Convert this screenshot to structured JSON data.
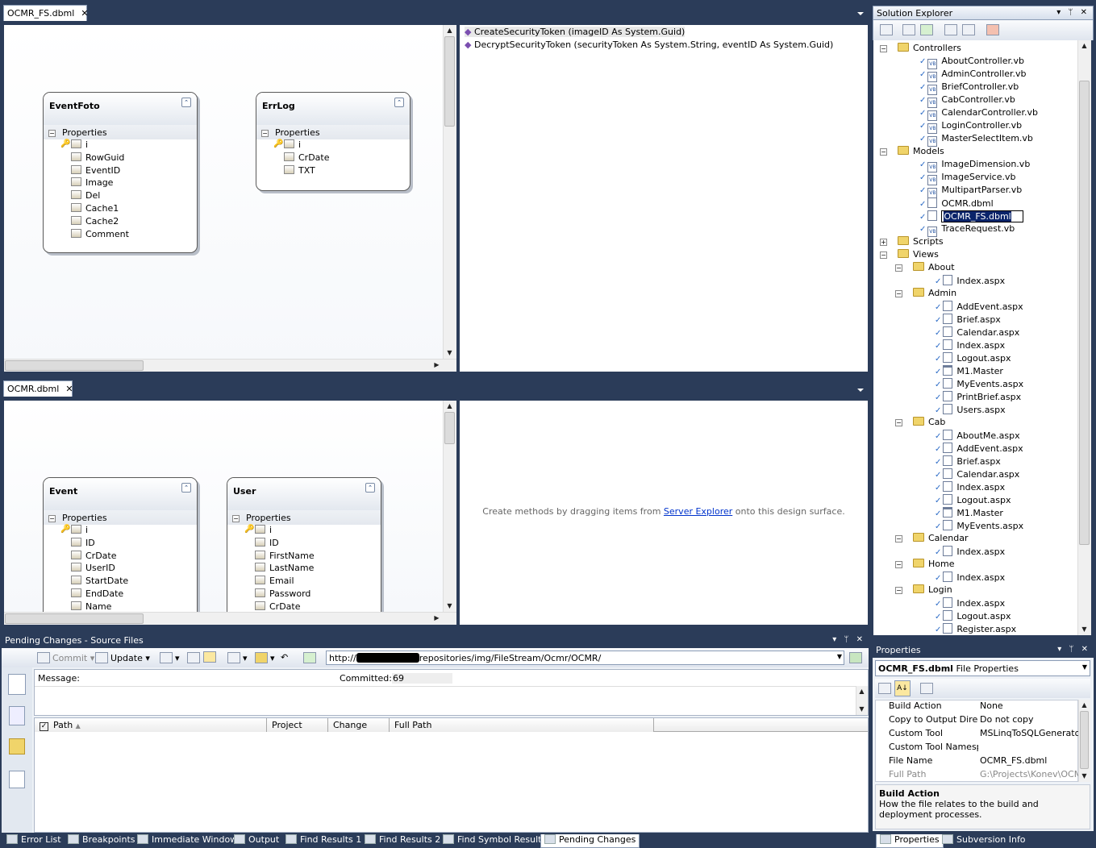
{
  "doc_top": {
    "tab": "OCMR_FS.dbml",
    "close": "✕",
    "entities": [
      {
        "name": "EventFoto",
        "section": "Properties",
        "fields": [
          "i",
          "RowGuid",
          "EventID",
          "Image",
          "Del",
          "Cache1",
          "Cache2",
          "Comment"
        ]
      },
      {
        "name": "ErrLog",
        "section": "Properties",
        "fields": [
          "i",
          "CrDate",
          "TXT"
        ]
      }
    ],
    "methods": [
      "CreateSecurityToken (imageID As System.Guid)",
      "DecryptSecurityToken (securityToken As System.String, eventID As System.Guid)"
    ]
  },
  "doc_bottom": {
    "tab": "OCMR.dbml",
    "close": "✕",
    "entities": [
      {
        "name": "Event",
        "section": "Properties",
        "fields": [
          "i",
          "ID",
          "CrDate",
          "UserID",
          "StartDate",
          "EndDate",
          "Name"
        ]
      },
      {
        "name": "User",
        "section": "Properties",
        "fields": [
          "i",
          "ID",
          "FirstName",
          "LastName",
          "Email",
          "Password",
          "CrDate"
        ]
      }
    ],
    "empty_text_before": "Create methods by dragging items from ",
    "empty_link": "Server Explorer",
    "empty_text_after": " onto this design surface."
  },
  "solution_explorer": {
    "title": "Solution Explorer",
    "header_icons": "▾ ᛘ ✕",
    "items": [
      {
        "label": "Controllers",
        "type": "folder",
        "level": 0,
        "expander": "⊟"
      },
      {
        "label": "AboutController.vb",
        "type": "vb",
        "level": 1
      },
      {
        "label": "AdminController.vb",
        "type": "vb",
        "level": 1
      },
      {
        "label": "BriefController.vb",
        "type": "vb",
        "level": 1
      },
      {
        "label": "CabController.vb",
        "type": "vb",
        "level": 1
      },
      {
        "label": "CalendarController.vb",
        "type": "vb",
        "level": 1
      },
      {
        "label": "LoginController.vb",
        "type": "vb",
        "level": 1
      },
      {
        "label": "MasterSelectItem.vb",
        "type": "vb",
        "level": 1
      },
      {
        "label": "Models",
        "type": "folder",
        "level": 0,
        "expander": "⊟"
      },
      {
        "label": "ImageDimension.vb",
        "type": "vb",
        "level": 1
      },
      {
        "label": "ImageService.vb",
        "type": "vb",
        "level": 1
      },
      {
        "label": "MultipartParser.vb",
        "type": "vb",
        "level": 1
      },
      {
        "label": "OCMR.dbml",
        "type": "dbml",
        "level": 1
      },
      {
        "label": "OCMR_FS.dbml",
        "type": "dbml",
        "level": 1,
        "editing": true
      },
      {
        "label": "TraceRequest.vb",
        "type": "vb",
        "level": 1
      },
      {
        "label": "Scripts",
        "type": "folder",
        "level": 0,
        "expander": "⊞"
      },
      {
        "label": "Views",
        "type": "folder",
        "level": 0,
        "expander": "⊟"
      },
      {
        "label": "About",
        "type": "folder",
        "level": 1,
        "expander": "⊟"
      },
      {
        "label": "Index.aspx",
        "type": "aspx",
        "level": 2
      },
      {
        "label": "Admin",
        "type": "folder",
        "level": 1,
        "expander": "⊟"
      },
      {
        "label": "AddEvent.aspx",
        "type": "aspx",
        "level": 2
      },
      {
        "label": "Brief.aspx",
        "type": "aspx",
        "level": 2
      },
      {
        "label": "Calendar.aspx",
        "type": "aspx",
        "level": 2
      },
      {
        "label": "Index.aspx",
        "type": "aspx",
        "level": 2
      },
      {
        "label": "Logout.aspx",
        "type": "aspx",
        "level": 2
      },
      {
        "label": "M1.Master",
        "type": "master",
        "level": 2
      },
      {
        "label": "MyEvents.aspx",
        "type": "aspx",
        "level": 2
      },
      {
        "label": "PrintBrief.aspx",
        "type": "aspx",
        "level": 2
      },
      {
        "label": "Users.aspx",
        "type": "aspx",
        "level": 2
      },
      {
        "label": "Cab",
        "type": "folder",
        "level": 1,
        "expander": "⊟"
      },
      {
        "label": "AboutMe.aspx",
        "type": "aspx",
        "level": 2
      },
      {
        "label": "AddEvent.aspx",
        "type": "aspx",
        "level": 2
      },
      {
        "label": "Brief.aspx",
        "type": "aspx",
        "level": 2
      },
      {
        "label": "Calendar.aspx",
        "type": "aspx",
        "level": 2
      },
      {
        "label": "Index.aspx",
        "type": "aspx",
        "level": 2
      },
      {
        "label": "Logout.aspx",
        "type": "aspx",
        "level": 2
      },
      {
        "label": "M1.Master",
        "type": "master",
        "level": 2
      },
      {
        "label": "MyEvents.aspx",
        "type": "aspx",
        "level": 2
      },
      {
        "label": "Calendar",
        "type": "folder",
        "level": 1,
        "expander": "⊟"
      },
      {
        "label": "Index.aspx",
        "type": "aspx",
        "level": 2
      },
      {
        "label": "Home",
        "type": "folder",
        "level": 1,
        "expander": "⊟"
      },
      {
        "label": "Index.aspx",
        "type": "aspx",
        "level": 2
      },
      {
        "label": "Login",
        "type": "folder",
        "level": 1,
        "expander": "⊟"
      },
      {
        "label": "Index.aspx",
        "type": "aspx",
        "level": 2
      },
      {
        "label": "Logout.aspx",
        "type": "aspx",
        "level": 2
      },
      {
        "label": "Register.aspx",
        "type": "aspx",
        "level": 2
      }
    ]
  },
  "properties": {
    "title": "Properties",
    "header_icons": "▾ ᛘ ✕",
    "object_name": "OCMR_FS.dbml",
    "object_type": "File Properties",
    "rows": [
      {
        "key": "Build Action",
        "value": "None"
      },
      {
        "key": "Copy to Output Directo",
        "value": "Do not copy"
      },
      {
        "key": "Custom Tool",
        "value": "MSLinqToSQLGenerator"
      },
      {
        "key": "Custom Tool Namespac",
        "value": ""
      },
      {
        "key": "File Name",
        "value": "OCMR_FS.dbml"
      },
      {
        "key": "Full Path",
        "value": "G:\\Projects\\Konev\\OCMR"
      }
    ],
    "desc_title": "Build Action",
    "desc_text": "How the file relates to the build and deployment processes."
  },
  "pending": {
    "title": "Pending Changes - Source Files",
    "header_icons": "▾ ᛘ ✕",
    "commit_label": "Commit",
    "update_label": "Update",
    "url_prefix": "http://",
    "url_suffix": "repositories/img/FileStream/Ocmr/OCMR/",
    "message_label": "Message:",
    "committed_label": "Committed:",
    "committed_value": "69",
    "columns": [
      "Path",
      "Project",
      "Change",
      "Full Path"
    ]
  },
  "bottom_tabs": [
    "Error List",
    "Breakpoints",
    "Immediate Window",
    "Output",
    "Find Results 1",
    "Find Results 2",
    "Find Symbol Results",
    "Pending Changes"
  ],
  "right_bottom_tabs": [
    "Properties",
    "Subversion Info"
  ]
}
